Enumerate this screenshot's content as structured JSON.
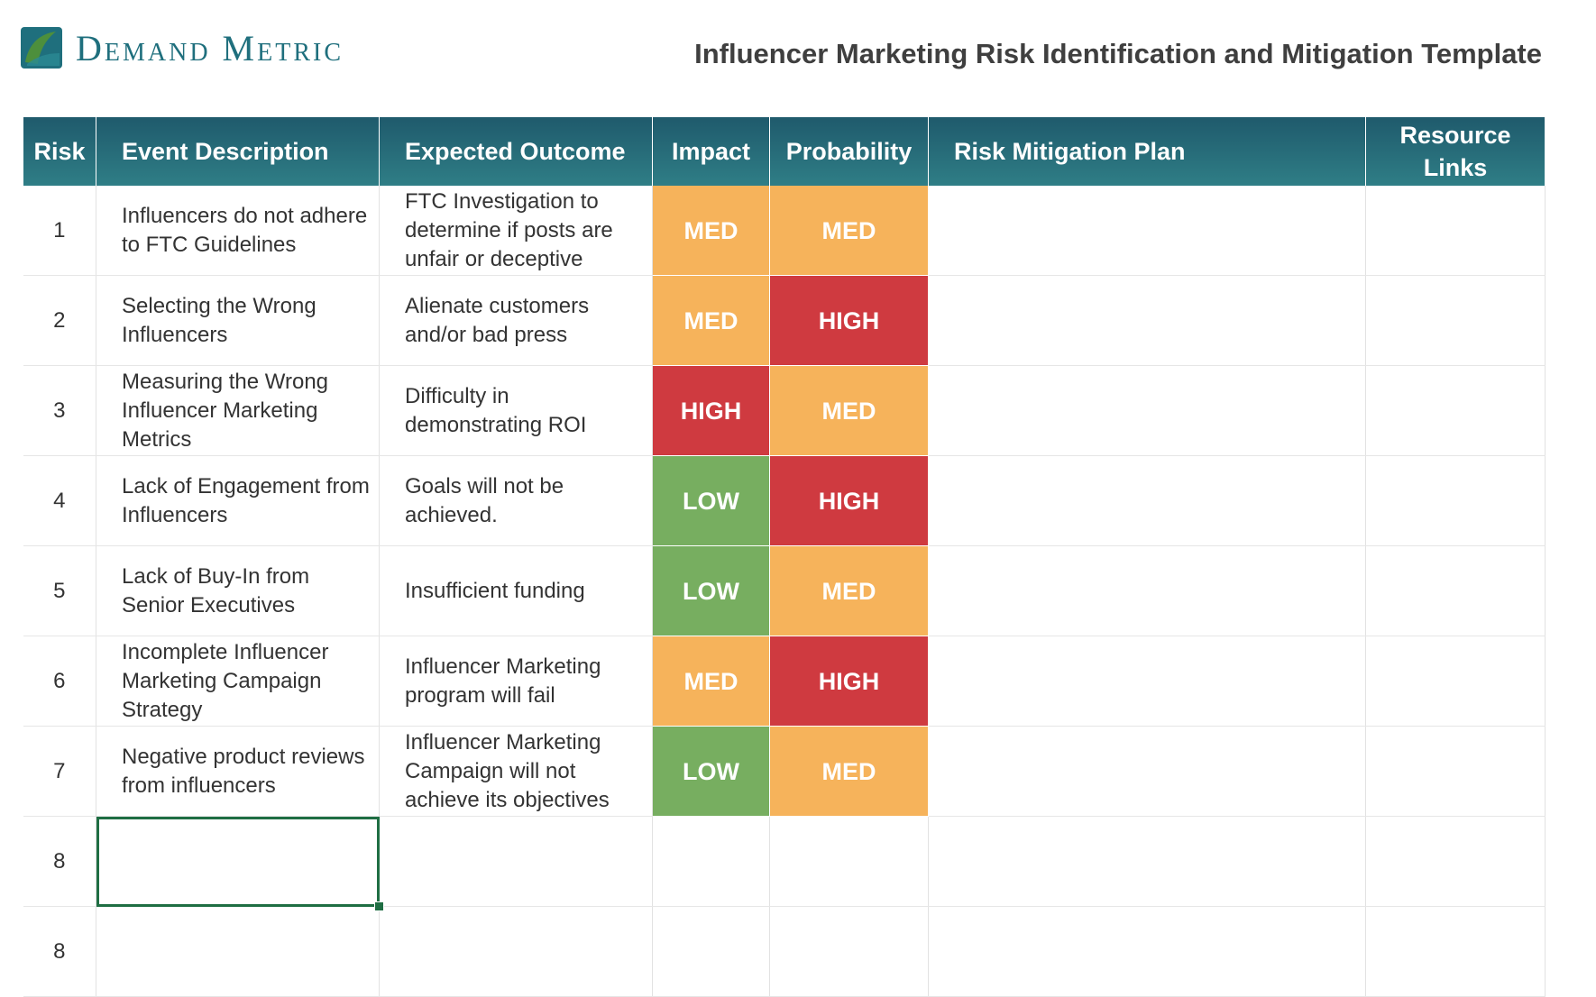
{
  "brand": {
    "name": "Demand Metric",
    "colors": {
      "teal": "#1f6f7d",
      "green": "#4d8f3c"
    }
  },
  "title": "Influencer Marketing Risk Identification and Mitigation Template",
  "table": {
    "headers": {
      "risk": "Risk",
      "event": "Event Description",
      "outcome": "Expected Outcome",
      "impact": "Impact",
      "probability": "Probability",
      "mitigation": "Risk Mitigation Plan",
      "links": "Resource Links"
    },
    "rating_colors": {
      "MED": "#f6b35b",
      "HIGH": "#cf3a40",
      "LOW": "#77ae60"
    },
    "rows": [
      {
        "risk": "1",
        "event": "Influencers do not adhere to FTC Guidelines",
        "outcome": "FTC Investigation to determine if posts are unfair or deceptive",
        "impact": "MED",
        "probability": "MED",
        "mitigation": "",
        "links": ""
      },
      {
        "risk": "2",
        "event": "Selecting the Wrong Influencers",
        "outcome": "Alienate customers and/or bad press",
        "impact": "MED",
        "probability": "HIGH",
        "mitigation": "",
        "links": ""
      },
      {
        "risk": "3",
        "event": "Measuring the Wrong Influencer Marketing Metrics",
        "outcome": "Difficulty in demonstrating ROI",
        "impact": "HIGH",
        "probability": "MED",
        "mitigation": "",
        "links": ""
      },
      {
        "risk": "4",
        "event": "Lack of Engagement from Influencers",
        "outcome": "Goals will not be achieved.",
        "impact": "LOW",
        "probability": "HIGH",
        "mitigation": "",
        "links": ""
      },
      {
        "risk": "5",
        "event": "Lack of Buy-In from Senior Executives",
        "outcome": "Insufficient funding",
        "impact": "LOW",
        "probability": "MED",
        "mitigation": "",
        "links": ""
      },
      {
        "risk": "6",
        "event": "Incomplete Influencer Marketing Campaign Strategy",
        "outcome": "Influencer Marketing program will fail",
        "impact": "MED",
        "probability": "HIGH",
        "mitigation": "",
        "links": ""
      },
      {
        "risk": "7",
        "event": "Negative product reviews from influencers",
        "outcome": "Influencer Marketing Campaign will not achieve its objectives",
        "impact": "LOW",
        "probability": "MED",
        "mitigation": "",
        "links": ""
      }
    ],
    "empty_rows": [
      "8",
      "8"
    ]
  }
}
